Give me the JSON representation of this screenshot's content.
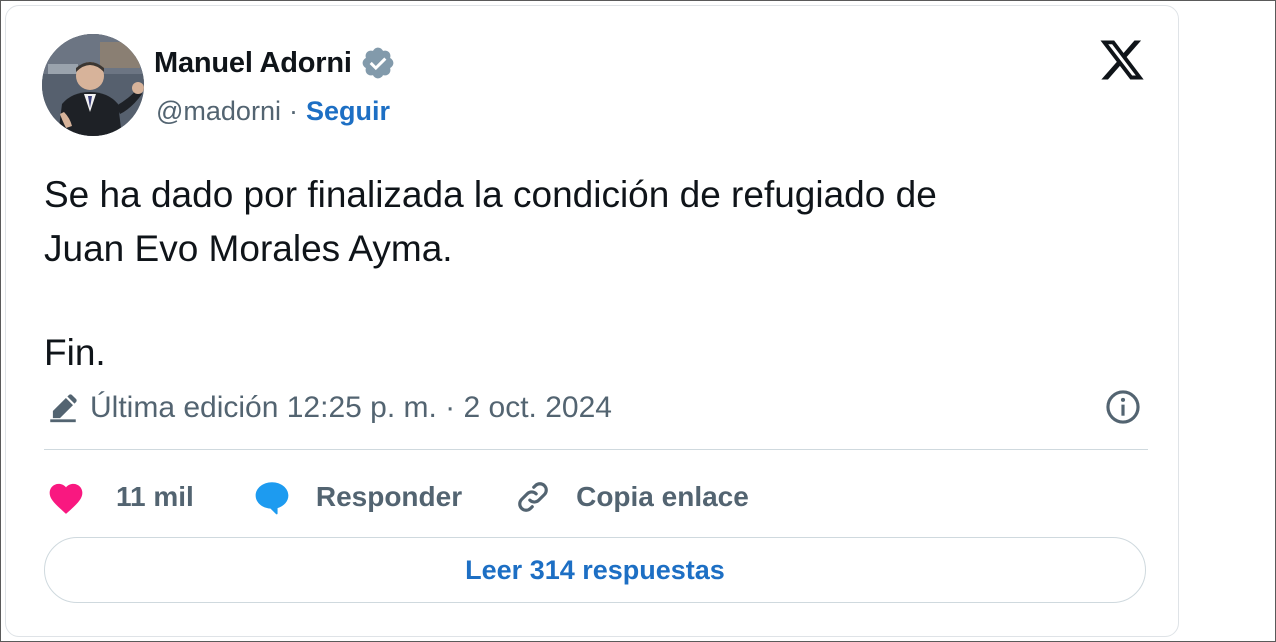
{
  "author": {
    "name": "Manuel Adorni",
    "handle": "@madorni",
    "separator": "·",
    "follow_label": "Seguir"
  },
  "tweet": {
    "lines": [
      "Se ha dado por finalizada la condición de refugiado de",
      "Juan Evo Morales Ayma.",
      "Fin."
    ]
  },
  "edit_info": {
    "text": "Última edición 12:25 p. m. · 2 oct. 2024"
  },
  "actions": {
    "likes": "11 mil",
    "reply_label": "Responder",
    "copy_link_label": "Copia enlace"
  },
  "read_replies_label": "Leer 314 respuestas",
  "icons": {
    "verified": "verified-badge-icon",
    "platform": "x-logo-icon",
    "edit": "pencil-icon",
    "info": "info-icon",
    "like": "heart-icon",
    "reply": "speech-bubble-icon",
    "copy": "link-icon"
  },
  "colors": {
    "text": "#0f1419",
    "muted": "#536471",
    "link": "#1d6fc4",
    "heart": "#f91880",
    "reply_bubble": "#1d9bf0",
    "verified_badge": "#829aab",
    "border": "#cfd9de"
  }
}
